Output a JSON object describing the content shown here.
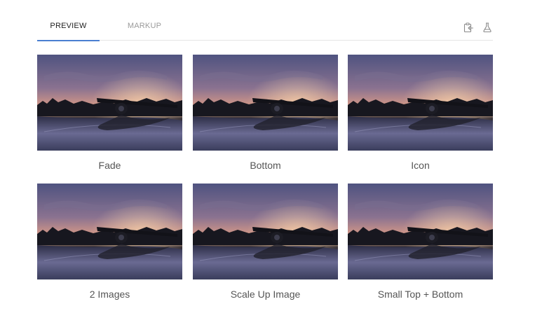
{
  "tabs": {
    "preview": "PREVIEW",
    "markup": "MARKUP",
    "active": "PREVIEW"
  },
  "toolbar": {
    "copy_icon": "copy-to-clipboard-icon",
    "flask_icon": "flask-icon"
  },
  "colors": {
    "active_tab_underline": "#4a7fd1",
    "sky_top": "#5a5f8c",
    "sunset": "#e8a27a",
    "treeline": "#1a1a24",
    "ground": "#3b3e5e"
  },
  "cards": [
    {
      "caption": "Fade"
    },
    {
      "caption": "Bottom"
    },
    {
      "caption": "Icon"
    },
    {
      "caption": "2 Images"
    },
    {
      "caption": "Scale Up Image"
    },
    {
      "caption": "Small Top + Bottom"
    }
  ]
}
